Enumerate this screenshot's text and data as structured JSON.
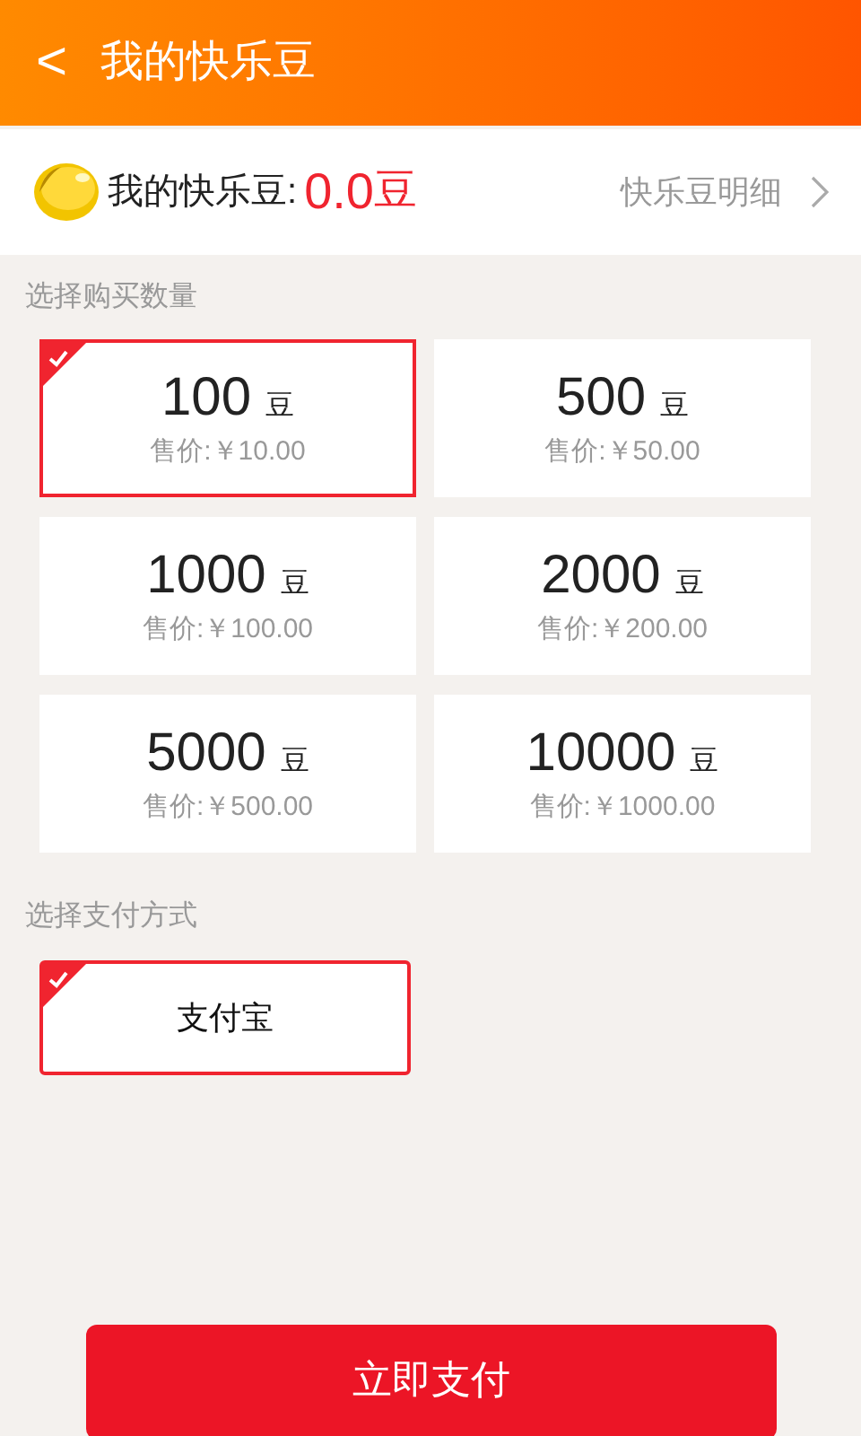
{
  "header": {
    "back": "<",
    "title": "我的快乐豆"
  },
  "balance": {
    "label": "我的快乐豆:",
    "amount": "0.0",
    "unit": "豆",
    "detail_link": "快乐豆明细"
  },
  "quantity": {
    "label": "选择购买数量",
    "options": [
      {
        "amount": "100",
        "unit": "豆",
        "price": "售价:￥10.00",
        "selected": true
      },
      {
        "amount": "500",
        "unit": "豆",
        "price": "售价:￥50.00",
        "selected": false
      },
      {
        "amount": "1000",
        "unit": "豆",
        "price": "售价:￥100.00",
        "selected": false
      },
      {
        "amount": "2000",
        "unit": "豆",
        "price": "售价:￥200.00",
        "selected": false
      },
      {
        "amount": "5000",
        "unit": "豆",
        "price": "售价:￥500.00",
        "selected": false
      },
      {
        "amount": "10000",
        "unit": "豆",
        "price": "售价:￥1000.00",
        "selected": false
      }
    ]
  },
  "payment": {
    "label": "选择支付方式",
    "methods": [
      {
        "name": "支付宝",
        "selected": true
      }
    ]
  },
  "pay_button": "立即支付"
}
